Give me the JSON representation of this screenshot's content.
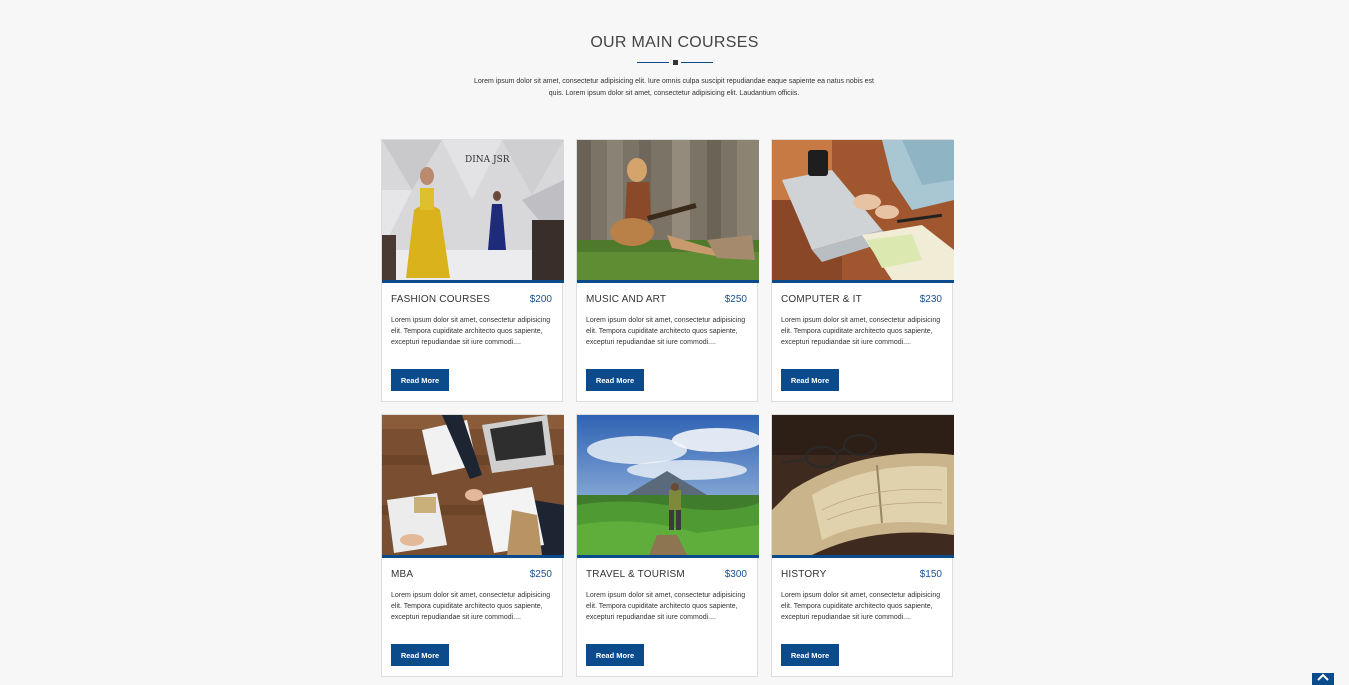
{
  "section": {
    "title": "OUR MAIN COURSES",
    "intro": "Lorem ipsum dolor sit amet, consectetur adipisicing elit. Iure omnis culpa suscipit repudiandae eaque sapiente ea natus nobis est quis. Lorem ipsum dolor sit amet, consectetur adipisicing elit. Laudantium officiis."
  },
  "colors": {
    "accent": "#0b4a8b",
    "background": "#f7f7f7"
  },
  "courses": [
    {
      "name": "FASHION COURSES",
      "price": "$200",
      "desc": "Lorem ipsum dolor sit amet, consectetur adipisicing elit. Tempora cupiditate architecto quos sapiente, excepturi repudiandae sit iure commodi....",
      "button": "Read More",
      "image": "fashion-runway-photo"
    },
    {
      "name": "MUSIC AND ART",
      "price": "$250",
      "desc": "Lorem ipsum dolor sit amet, consectetur adipisicing elit. Tempora cupiditate architecto quos sapiente, excepturi repudiandae sit iure commodi....",
      "button": "Read More",
      "image": "guitar-player-photo"
    },
    {
      "name": "COMPUTER & IT",
      "price": "$230",
      "desc": "Lorem ipsum dolor sit amet, consectetur adipisicing elit. Tempora cupiditate architecto quos sapiente, excepturi repudiandae sit iure commodi....",
      "button": "Read More",
      "image": "laptop-typing-photo"
    },
    {
      "name": "MBA",
      "price": "$250",
      "desc": "Lorem ipsum dolor sit amet, consectetur adipisicing elit. Tempora cupiditate architecto quos sapiente, excepturi repudiandae sit iure commodi....",
      "button": "Read More",
      "image": "business-handshake-photo"
    },
    {
      "name": "TRAVEL & TOURISM",
      "price": "$300",
      "desc": "Lorem ipsum dolor sit amet, consectetur adipisicing elit. Tempora cupiditate architecto quos sapiente, excepturi repudiandae sit iure commodi....",
      "button": "Read More",
      "image": "mountain-hiker-photo"
    },
    {
      "name": "HISTORY",
      "price": "$150",
      "desc": "Lorem ipsum dolor sit amet, consectetur adipisicing elit. Tempora cupiditate architecto quos sapiente, excepturi repudiandae sit iure commodi....",
      "button": "Read More",
      "image": "old-book-glasses-photo"
    }
  ],
  "scroll_top": {
    "icon": "chevron-up-icon"
  }
}
